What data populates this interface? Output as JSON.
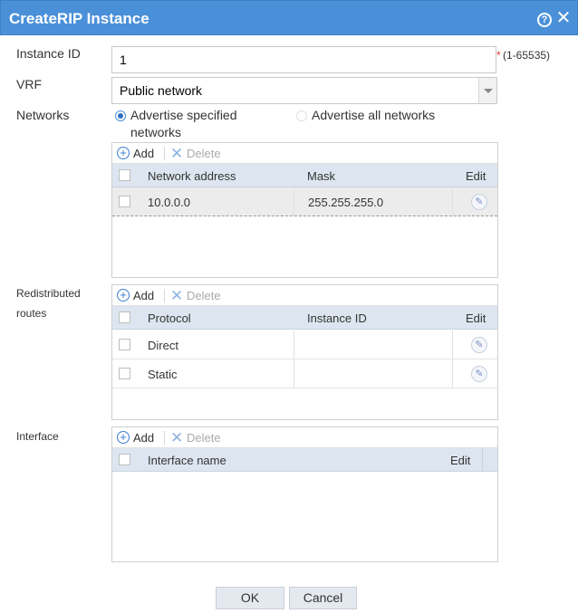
{
  "dialog": {
    "title": "CreateRIP Instance",
    "help_icon": "help-icon",
    "close_icon": "close-icon",
    "accent_color": "#4a90d9"
  },
  "form": {
    "instance_id": {
      "label": "Instance ID",
      "value": "1",
      "required_mark": "*",
      "range_hint": "(1-65535)"
    },
    "vrf": {
      "label": "VRF",
      "value": "Public network"
    },
    "networks": {
      "label": "Networks",
      "options": [
        {
          "label_line1": "Advertise specified",
          "label_line2": "networks",
          "checked": true
        },
        {
          "label_line1": "Advertise all networks",
          "label_line2": "",
          "checked": false
        }
      ]
    }
  },
  "toolbar": {
    "add_label": "Add",
    "delete_label": "Delete",
    "add_icon": "plus-circle-icon",
    "delete_icon": "x-icon"
  },
  "networks_table": {
    "columns": [
      "Network address",
      "Mask",
      "Edit"
    ],
    "rows": [
      {
        "address": "10.0.0.0",
        "mask": "255.255.255.0",
        "selected": true
      }
    ]
  },
  "redistributed": {
    "label_line1": "Redistributed",
    "label_line2": "routes",
    "columns": [
      "Protocol",
      "Instance ID",
      "Edit"
    ],
    "rows": [
      {
        "protocol": "Direct",
        "instance_id": ""
      },
      {
        "protocol": "Static",
        "instance_id": ""
      }
    ]
  },
  "interface": {
    "label": "Interface",
    "columns": [
      "Interface name",
      "Edit"
    ],
    "rows": []
  },
  "footer": {
    "ok_label": "OK",
    "cancel_label": "Cancel"
  }
}
